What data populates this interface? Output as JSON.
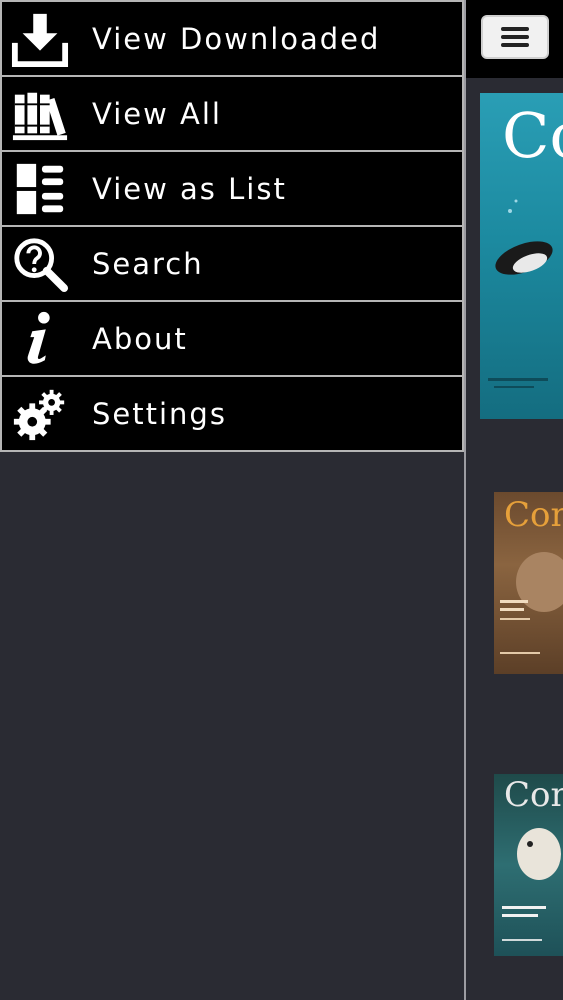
{
  "drawer": {
    "items": [
      {
        "label": "View Downloaded",
        "icon": "download-icon"
      },
      {
        "label": "View All",
        "icon": "books-icon"
      },
      {
        "label": "View as List",
        "icon": "list-view-icon"
      },
      {
        "label": "Search",
        "icon": "search-question-icon"
      },
      {
        "label": "About",
        "icon": "info-icon"
      },
      {
        "label": "Settings",
        "icon": "gears-icon"
      }
    ]
  },
  "toolbar": {
    "menu_icon": "hamburger-icon"
  },
  "covers": [
    {
      "logo": "Co",
      "accent": "#1d8aa3"
    },
    {
      "logo": "Con",
      "accent": "#e6a03a"
    },
    {
      "logo": "Con",
      "accent": "#e8e8e8"
    }
  ],
  "colors": {
    "drawer_bg": "#000000",
    "border": "#b5b5b5",
    "background": "#2a2b33"
  }
}
